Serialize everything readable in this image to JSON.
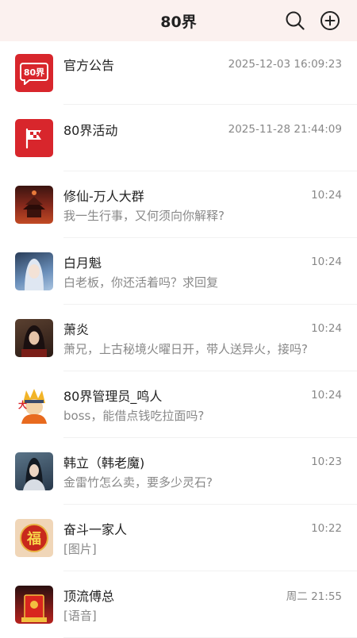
{
  "header": {
    "title": "80界"
  },
  "conversations": [
    {
      "name": "官方公告",
      "time": "2025-12-03 16:09:23",
      "message": "",
      "avatar": "brand-logo-icon",
      "color": "#d8262c"
    },
    {
      "name": "80界活动",
      "time": "2025-11-28 21:44:09",
      "message": "",
      "avatar": "flag-icon",
      "color": "#d8262c"
    },
    {
      "name": "修仙-万人大群",
      "time": "10:24",
      "message": "我一生行事，又何须向你解释?",
      "avatar": "palace-avatar",
      "color": "#7a2418"
    },
    {
      "name": "白月魁",
      "time": "10:24",
      "message": "白老板，你还活着吗？求回复",
      "avatar": "white-hair-woman-avatar",
      "color": "#5a7ea8"
    },
    {
      "name": "萧炎",
      "time": "10:24",
      "message": "萧兄，上古秘境火曜日开，带人送异火，接吗?",
      "avatar": "warrior-avatar",
      "color": "#4a3328"
    },
    {
      "name": "80界管理员_鸣人",
      "time": "10:24",
      "message": "boss，能借点钱吃拉面吗?",
      "avatar": "ninja-avatar",
      "color": "#f2a23a"
    },
    {
      "name": "韩立（韩老魔)",
      "time": "10:23",
      "message": "金雷竹怎么卖，要多少灵石?",
      "avatar": "cultivator-avatar",
      "color": "#3d5568"
    },
    {
      "name": "奋斗一家人",
      "time": "10:22",
      "message": "[图片]",
      "avatar": "fortune-avatar",
      "color": "#e8c9a8"
    },
    {
      "name": "顶流傅总",
      "time": "周二 21:55",
      "message": "[语音]",
      "avatar": "red-packet-avatar",
      "color": "#b8221e"
    }
  ]
}
